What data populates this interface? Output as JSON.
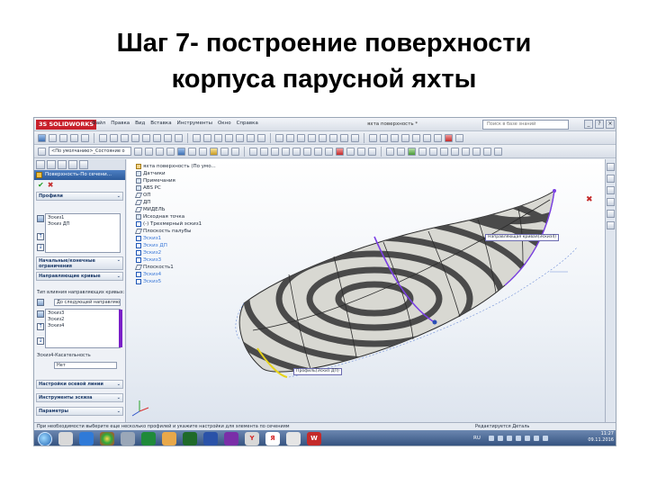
{
  "slide": {
    "title_line1": "Шаг 7- построение поверхности",
    "title_line2": "корпуса парусной яхты"
  },
  "app": {
    "logo": "3S SOLIDWORKS",
    "menu": [
      "Файл",
      "Правка",
      "Вид",
      "Вставка",
      "Инструменты",
      "Окно",
      "Справка"
    ],
    "document_title": "яхта поверхность *",
    "search_placeholder": "Поиск в базе знаний",
    "configuration_select": "<По умолчанию>_Состояние о"
  },
  "property_manager": {
    "title": "Поверхность-По сечени...",
    "ok_symbol": "✔",
    "cancel_symbol": "✖",
    "profiles_header": "Профили",
    "profiles": [
      "Эскиз1",
      "Эскиз ДП"
    ],
    "constraints_header": "Начальные/конечные ограничения",
    "guides_header": "Направляющие кривые",
    "guide_influence_label": "Тип влияния направляющих кривых:",
    "guide_influence_value": "До следующей направляю",
    "guides": [
      "Эскиз3",
      "Эскиз2",
      "Эскиз4"
    ],
    "tangency_label": "Эскиз4-Касательность",
    "tangency_value": "Нет",
    "centerline_header": "Настройки осевой линии",
    "sketch_tools_header": "Инструменты эскиза",
    "options_header": "Параметры",
    "chevron": "⌄"
  },
  "feature_tree": {
    "items": [
      {
        "label": "яхта поверхность  (По умо...",
        "type": "part"
      },
      {
        "label": "Датчики",
        "type": "folder"
      },
      {
        "label": "Примечания",
        "type": "folder"
      },
      {
        "label": "ABS PC",
        "type": "material"
      },
      {
        "label": "ОП",
        "type": "plane"
      },
      {
        "label": "ДП",
        "type": "plane"
      },
      {
        "label": "МИДЕЛЬ",
        "type": "plane"
      },
      {
        "label": "Исходная точка",
        "type": "origin"
      },
      {
        "label": "(-) Трехмерный эскиз1",
        "type": "sketch"
      },
      {
        "label": "Плоскость палубы",
        "type": "plane"
      },
      {
        "label": "Эскиз1",
        "type": "sketch"
      },
      {
        "label": "Эскиз ДП",
        "type": "sketch"
      },
      {
        "label": "Эскиз2",
        "type": "sketch"
      },
      {
        "label": "Эскиз3",
        "type": "sketch"
      },
      {
        "label": "Плоскость1",
        "type": "plane"
      },
      {
        "label": "Эскиз4",
        "type": "sketch"
      },
      {
        "label": "Эскиз5",
        "type": "sketch"
      }
    ]
  },
  "viewport": {
    "callout_guide": "Направляющая кривая(Эскиз4)",
    "callout_profile": "Профиль(Эскиз ДП)",
    "hull_pattern": "zebra-stripes",
    "accent_colors": {
      "guide": "#7b3fe4",
      "profile": "#e6d31a",
      "stripe_dark": "#4a4a4a",
      "stripe_light": "#d8d8d2"
    }
  },
  "status": {
    "message": "При необходимости выберите еще несколько профилей и укажите настройки для элемента по сечениям",
    "right_text": "Редактируется Деталь"
  },
  "taskbar": {
    "apps": [
      "Y",
      "Я",
      "W"
    ],
    "language": "RU",
    "time": "11:27",
    "date": "09.11.2016"
  }
}
